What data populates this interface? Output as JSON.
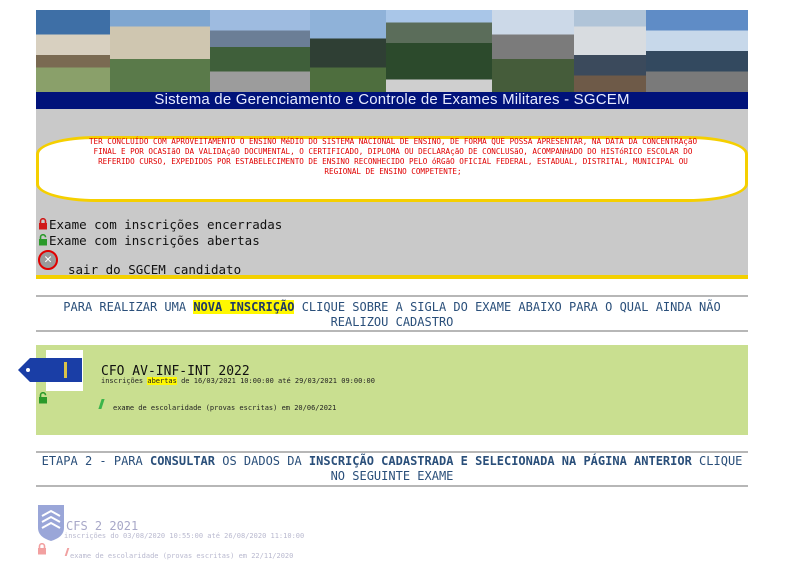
{
  "header": {
    "title": "Sistema de Gerenciamento e Controle de Exames Militares - SGCEM"
  },
  "notice": {
    "text": "TER CONCLUÍDO COM APROVEITAMENTO O ENSINO MéDIO DO SISTEMA NACIONAL DE ENSINO, DE FORMA QUE POSSA APRESENTAR, NA DATA DA CONCENTRAçãO FINAL E POR OCASIãO DA VALIDAçãO DOCUMENTAL, O CERTIFICADO, DIPLOMA OU DECLARAçãO DE CONCLUSãO, ACOMPANHADO DO HISTóRICO ESCOLAR DO REFERIDO CURSO, EXPEDIDOS POR ESTABELECIMENTO DE ENSINO RECONHECIDO PELO óRGãO OFICIAL FEDERAL, ESTADUAL, DISTRITAL, MUNICIPAL OU REGIONAL DE ENSINO COMPETENTE;"
  },
  "legend": {
    "closed": "Exame com inscrições encerradas",
    "open": "Exame com inscrições abertas",
    "exit": "sair do SGCEM candidato"
  },
  "section1": {
    "before": "PARA REALIZAR UMA ",
    "highlight": "NOVA INSCRIÇÃO",
    "after": " CLIQUE SOBRE A SIGLA DO EXAME ABAIXO PARA O QUAL AINDA NÃO REALIZOU CADASTRO"
  },
  "exam_open": {
    "name": "CFO AV-INF-INT 2022",
    "dates_prefix": "inscrições ",
    "dates_status": "abertas",
    "dates_suffix": " de 16/03/2021 10:00:00 até 29/03/2021 09:00:00",
    "written": "exame de escolaridade (provas escritas) em 20/06/2021"
  },
  "section2": {
    "part1": "ETAPA 2 - PARA ",
    "part2": "CONSULTAR",
    "part3": " OS DADOS DA ",
    "part4": "INSCRIÇÃO CADASTRADA E SELECIONADA NA PÁGINA ANTERIOR",
    "part5": " CLIQUE NO SEGUINTE EXAME"
  },
  "exam_closed": {
    "name": "CFS 2 2021",
    "dates": "inscrições do 03/08/2020 10:55:00 até 26/08/2020 11:10:00",
    "written": "exame de escolaridade (provas escritas) em 22/11/2020"
  },
  "colors": {
    "title_bar": "#00127a",
    "panel": "#c9c9c9",
    "accent_yellow": "#f5cf00",
    "notice_red": "#e00000",
    "exam_box": "#c9df90",
    "section_text": "#2a4f7a"
  }
}
